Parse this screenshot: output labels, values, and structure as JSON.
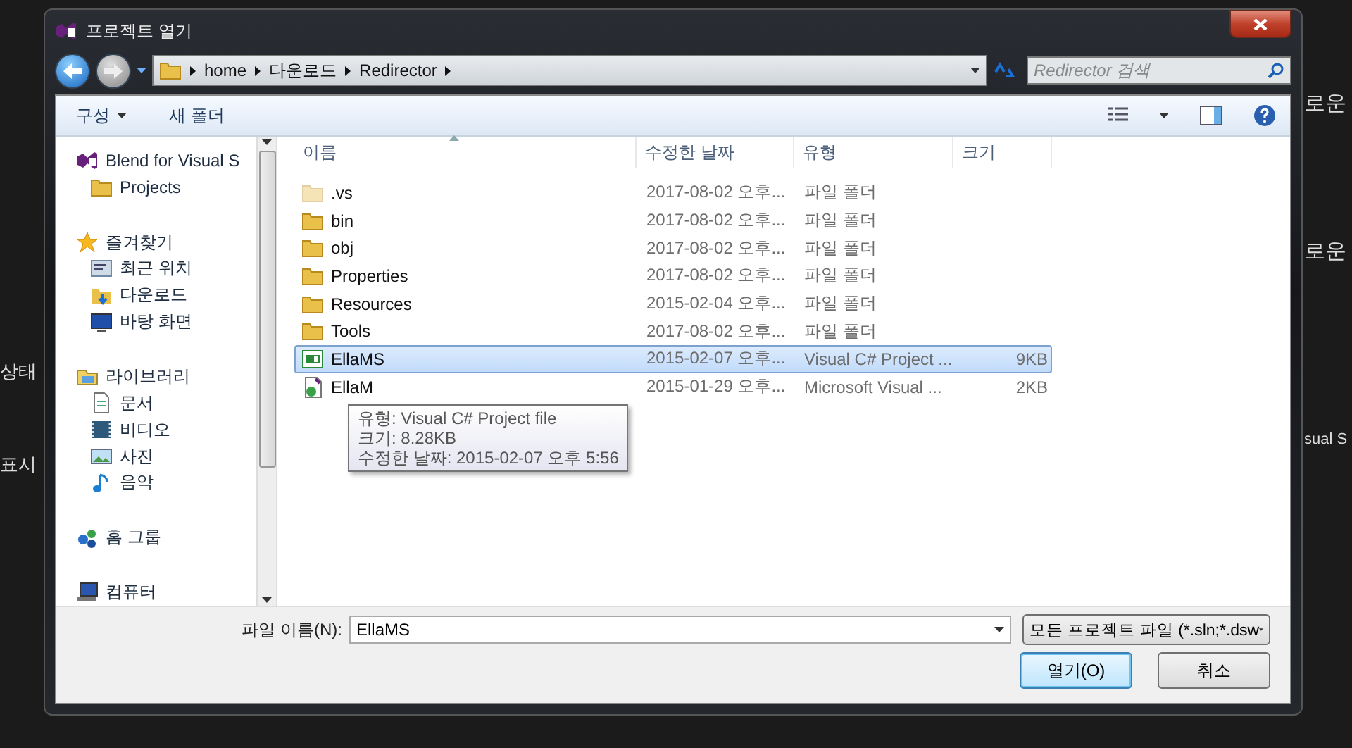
{
  "background": {
    "left_texts": [
      "상태",
      "표시"
    ],
    "right_texts": [
      "로운",
      "로운",
      "sual S"
    ]
  },
  "window": {
    "title": "프로젝트 열기"
  },
  "address": {
    "path": [
      "home",
      "다운로드",
      "Redirector"
    ],
    "search_placeholder": "Redirector 검색"
  },
  "toolbar": {
    "organize": "구성",
    "new_folder": "새 폴더"
  },
  "sidebar": {
    "groups": [
      {
        "label": "Blend for Visual S",
        "kind": "vs",
        "children": [
          {
            "label": "Projects",
            "kind": "folder"
          }
        ]
      },
      {
        "label": "즐겨찾기",
        "kind": "star",
        "children": [
          {
            "label": "최근 위치",
            "kind": "recent"
          },
          {
            "label": "다운로드",
            "kind": "download"
          },
          {
            "label": "바탕 화면",
            "kind": "desktop"
          }
        ]
      },
      {
        "label": "라이브러리",
        "kind": "library",
        "children": [
          {
            "label": "문서",
            "kind": "document"
          },
          {
            "label": "비디오",
            "kind": "video"
          },
          {
            "label": "사진",
            "kind": "picture"
          },
          {
            "label": "음악",
            "kind": "music"
          }
        ]
      },
      {
        "label": "홈 그룹",
        "kind": "homegroup"
      },
      {
        "label": "컴퓨터",
        "kind": "computer"
      }
    ]
  },
  "table": {
    "columns": [
      {
        "label": "이름",
        "sorted": true
      },
      {
        "label": "수정한 날짜",
        "sorted": false
      },
      {
        "label": "유형",
        "sorted": false
      },
      {
        "label": "크기",
        "sorted": false
      }
    ],
    "rows": [
      {
        "name": ".vs",
        "date": "2017-08-02 오후...",
        "type": "파일 폴더",
        "kind": "folder",
        "hidden": true,
        "selected": false
      },
      {
        "name": "bin",
        "date": "2017-08-02 오후...",
        "type": "파일 폴더",
        "kind": "folder",
        "hidden": false,
        "selected": false
      },
      {
        "name": "obj",
        "date": "2017-08-02 오후...",
        "type": "파일 폴더",
        "kind": "folder",
        "hidden": false,
        "selected": false
      },
      {
        "name": "Properties",
        "date": "2017-08-02 오후...",
        "type": "파일 폴더",
        "kind": "folder",
        "hidden": false,
        "selected": false
      },
      {
        "name": "Resources",
        "date": "2015-02-04 오후...",
        "type": "파일 폴더",
        "kind": "folder",
        "hidden": false,
        "selected": false
      },
      {
        "name": "Tools",
        "date": "2017-08-02 오후...",
        "type": "파일 폴더",
        "kind": "folder",
        "hidden": false,
        "selected": false
      },
      {
        "name": "EllaMS",
        "date": "2015-02-07 오후...",
        "type": "Visual C# Project ...",
        "size": "9KB",
        "kind": "csproj",
        "hidden": false,
        "selected": true
      },
      {
        "name": "EllaM",
        "date": "2015-01-29 오후...",
        "type": "Microsoft Visual ...",
        "size": "2KB",
        "kind": "solution",
        "hidden": false,
        "selected": false
      }
    ]
  },
  "tooltip": [
    "유형: Visual C# Project file",
    "크기: 8.28KB",
    "수정한 날짜: 2015-02-07 오후 5:56"
  ],
  "footer": {
    "filename_label": "파일 이름(N):",
    "filename_value": "EllaMS",
    "filter": "모든 프로젝트 파일 (*.sln;*.dsw",
    "buttons": [
      {
        "label": "열기(O)",
        "default": true
      },
      {
        "label": "취소",
        "default": false
      }
    ]
  }
}
